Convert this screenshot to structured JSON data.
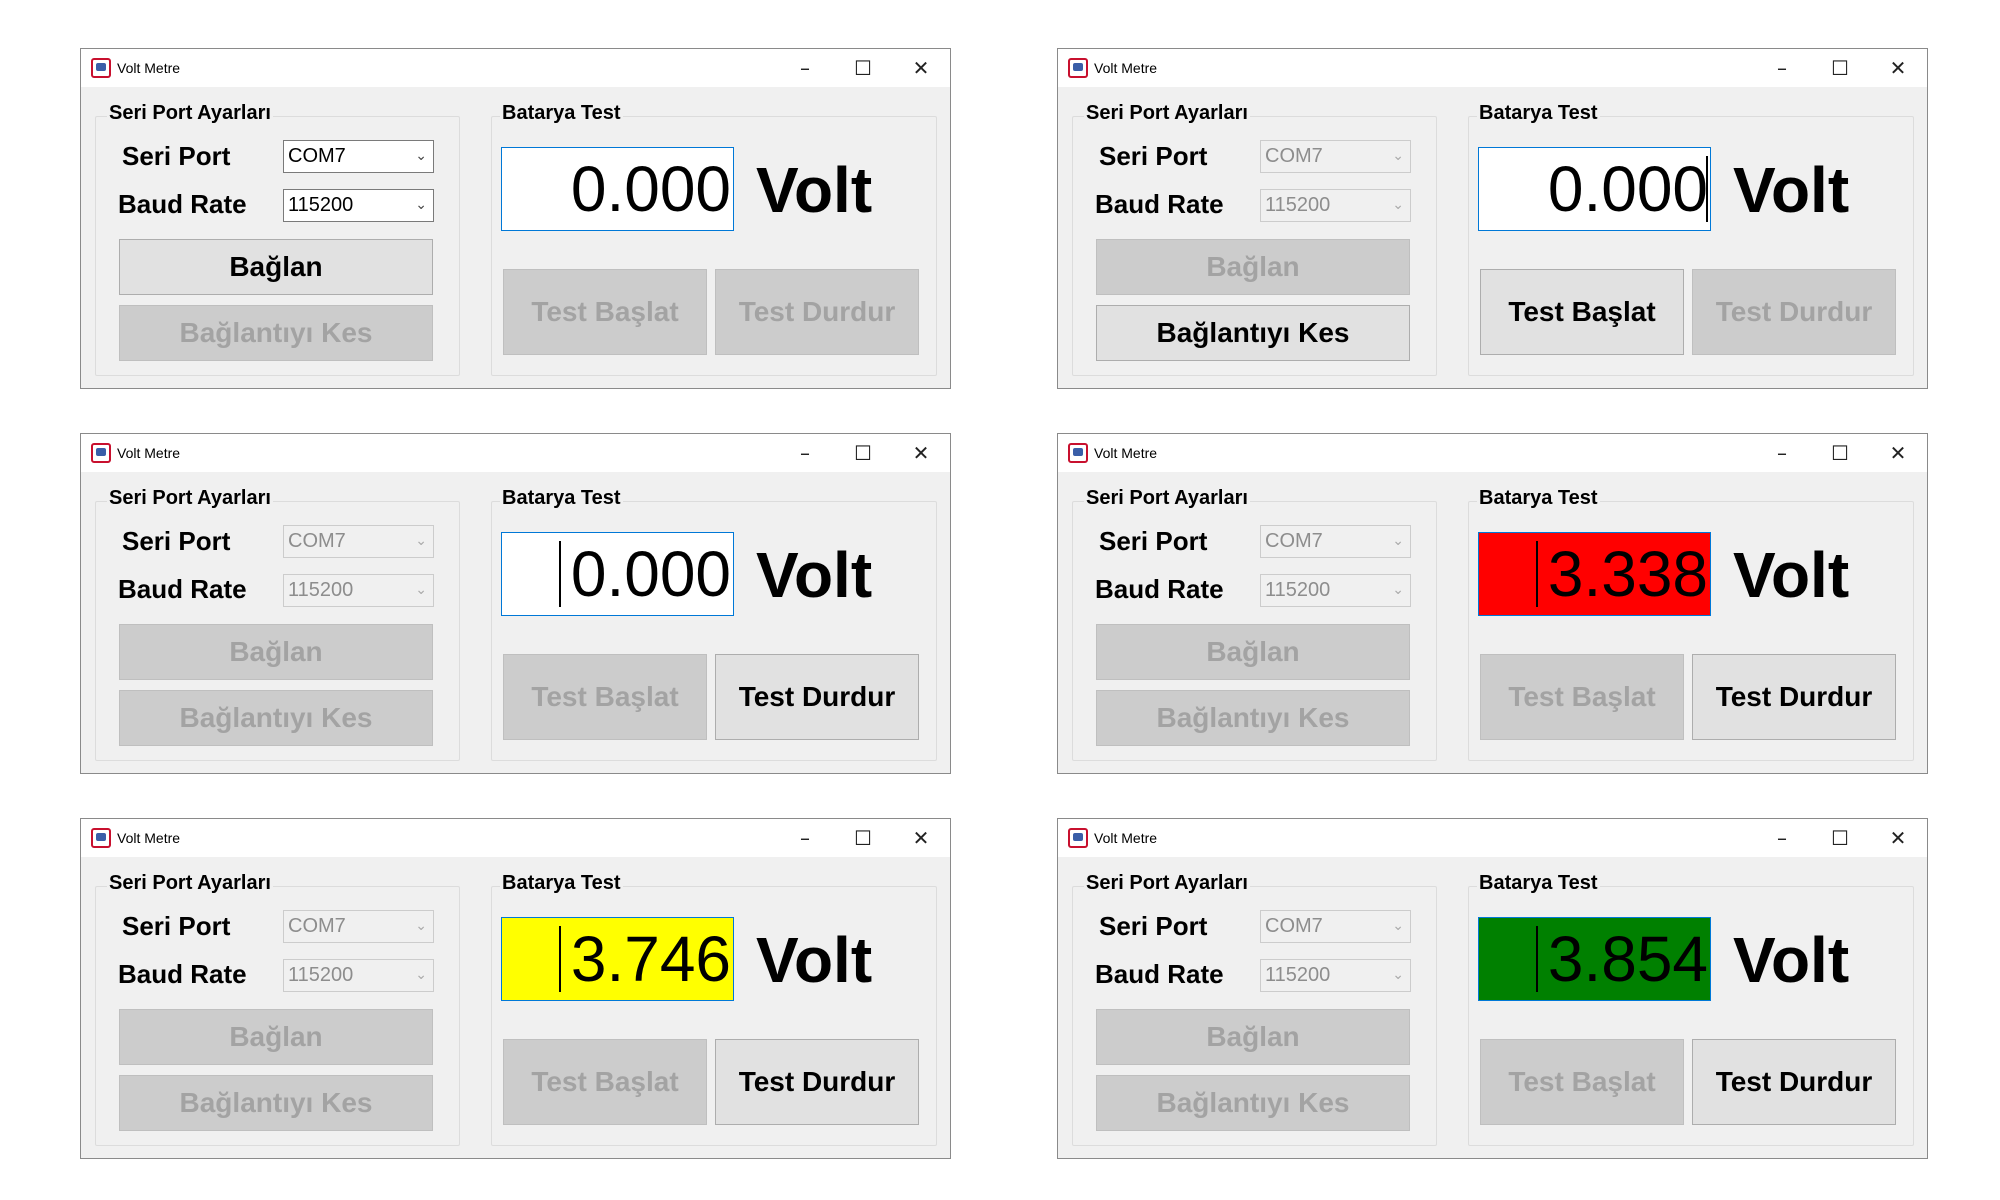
{
  "windows": [
    {
      "title": "Volt Metre",
      "serial_group": "Seri Port Ayarları",
      "port_label": "Seri Port",
      "port_value": "COM7",
      "baud_label": "Baud Rate",
      "baud_value": "115200",
      "connect_label": "Bağlan",
      "disconnect_label": "Bağlantıyı Kes",
      "battery_group": "Batarya Test",
      "voltage": "0.000",
      "unit": "Volt",
      "start_label": "Test Başlat",
      "stop_label": "Test Durdur",
      "display_color": "#ffffff",
      "port_enabled": true,
      "baud_enabled": true,
      "connect_enabled": true,
      "disconnect_enabled": false,
      "start_enabled": false,
      "stop_enabled": false
    },
    {
      "title": "Volt Metre",
      "serial_group": "Seri Port Ayarları",
      "port_label": "Seri Port",
      "port_value": "COM7",
      "baud_label": "Baud Rate",
      "baud_value": "115200",
      "connect_label": "Bağlan",
      "disconnect_label": "Bağlantıyı Kes",
      "battery_group": "Batarya Test",
      "voltage": "0.000",
      "unit": "Volt",
      "start_label": "Test Başlat",
      "stop_label": "Test Durdur",
      "display_color": "#ffffff",
      "port_enabled": false,
      "baud_enabled": false,
      "connect_enabled": false,
      "disconnect_enabled": true,
      "start_enabled": true,
      "stop_enabled": false
    },
    {
      "title": "Volt Metre",
      "serial_group": "Seri Port Ayarları",
      "port_label": "Seri Port",
      "port_value": "COM7",
      "baud_label": "Baud Rate",
      "baud_value": "115200",
      "connect_label": "Bağlan",
      "disconnect_label": "Bağlantıyı Kes",
      "battery_group": "Batarya Test",
      "voltage": "0.000",
      "unit": "Volt",
      "start_label": "Test Başlat",
      "stop_label": "Test Durdur",
      "display_color": "#ffffff",
      "port_enabled": false,
      "baud_enabled": false,
      "connect_enabled": false,
      "disconnect_enabled": false,
      "start_enabled": false,
      "stop_enabled": true
    },
    {
      "title": "Volt Metre",
      "serial_group": "Seri Port Ayarları",
      "port_label": "Seri Port",
      "port_value": "COM7",
      "baud_label": "Baud Rate",
      "baud_value": "115200",
      "connect_label": "Bağlan",
      "disconnect_label": "Bağlantıyı Kes",
      "battery_group": "Batarya Test",
      "voltage": "3.338",
      "unit": "Volt",
      "start_label": "Test Başlat",
      "stop_label": "Test Durdur",
      "display_color": "#ff0000",
      "port_enabled": false,
      "baud_enabled": false,
      "connect_enabled": false,
      "disconnect_enabled": false,
      "start_enabled": false,
      "stop_enabled": true
    },
    {
      "title": "Volt Metre",
      "serial_group": "Seri Port Ayarları",
      "port_label": "Seri Port",
      "port_value": "COM7",
      "baud_label": "Baud Rate",
      "baud_value": "115200",
      "connect_label": "Bağlan",
      "disconnect_label": "Bağlantıyı Kes",
      "battery_group": "Batarya Test",
      "voltage": "3.746",
      "unit": "Volt",
      "start_label": "Test Başlat",
      "stop_label": "Test Durdur",
      "display_color": "#ffff00",
      "port_enabled": false,
      "baud_enabled": false,
      "connect_enabled": false,
      "disconnect_enabled": false,
      "start_enabled": false,
      "stop_enabled": true
    },
    {
      "title": "Volt Metre",
      "serial_group": "Seri Port Ayarları",
      "port_label": "Seri Port",
      "port_value": "COM7",
      "baud_label": "Baud Rate",
      "baud_value": "115200",
      "connect_label": "Bağlan",
      "disconnect_label": "Bağlantıyı Kes",
      "battery_group": "Batarya Test",
      "voltage": "3.854",
      "unit": "Volt",
      "start_label": "Test Başlat",
      "stop_label": "Test Durdur",
      "display_color": "#008000",
      "port_enabled": false,
      "baud_enabled": false,
      "connect_enabled": false,
      "disconnect_enabled": false,
      "start_enabled": false,
      "stop_enabled": true
    }
  ]
}
